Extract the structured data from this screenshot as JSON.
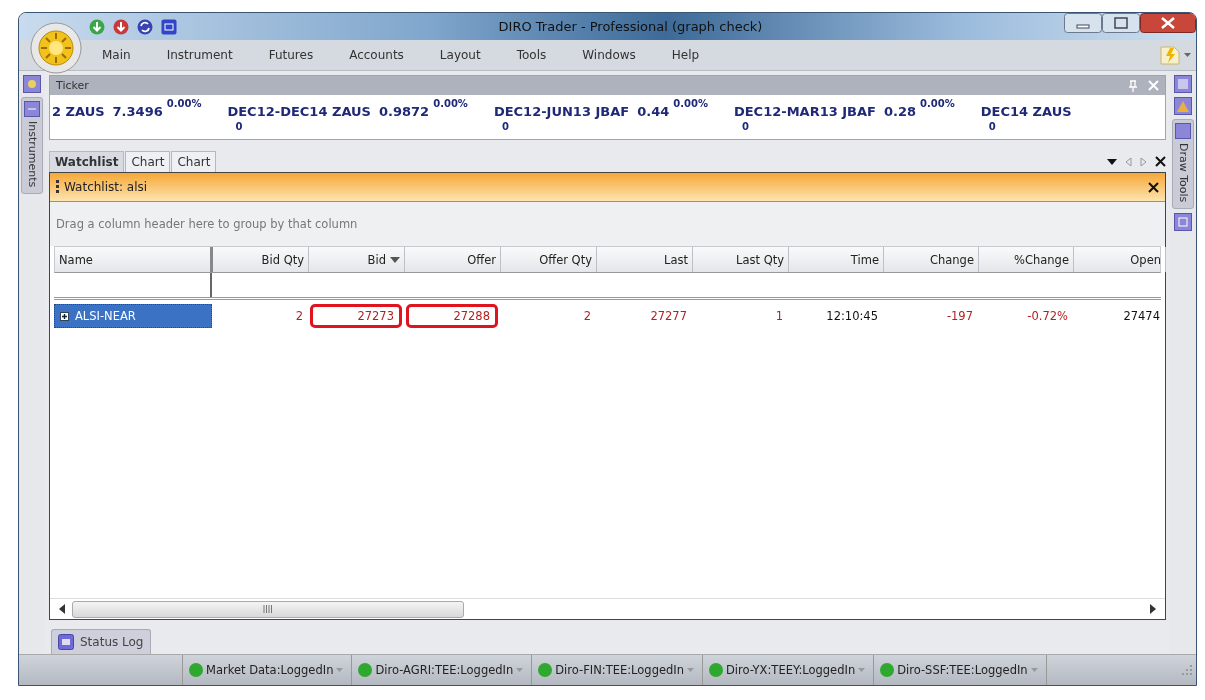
{
  "window": {
    "title": "DIRO Trader - Professional (graph check)"
  },
  "menu": [
    {
      "label": "Main"
    },
    {
      "label": "Instrument"
    },
    {
      "label": "Futures"
    },
    {
      "label": "Accounts"
    },
    {
      "label": "Layout"
    },
    {
      "label": "Tools"
    },
    {
      "label": "Windows"
    },
    {
      "label": "Help"
    }
  ],
  "left_dock": {
    "tabs": [
      {
        "label": "Instruments"
      }
    ]
  },
  "right_dock": {
    "tabs": [
      {
        "label": "Draw Tools"
      }
    ]
  },
  "ticker": {
    "title": "Ticker",
    "items": [
      {
        "symbol": "2 ZAUS",
        "price": "7.3496",
        "change": "0.00%"
      },
      {
        "symbol": "DEC12-DEC14 ZAUS",
        "price": "0.9872",
        "change": "0.00%",
        "volume": "0"
      },
      {
        "symbol": "DEC12-JUN13 JBAF",
        "price": "0.44",
        "change": "0.00%",
        "volume": "0"
      },
      {
        "symbol": "DEC12-MAR13 JBAF",
        "price": "0.28",
        "change": "0.00%",
        "volume": "0"
      },
      {
        "symbol": "DEC14 ZAUS",
        "volume": "0"
      }
    ]
  },
  "tabs": [
    {
      "label": "Watchlist",
      "selected": true
    },
    {
      "label": "Chart",
      "selected": false
    },
    {
      "label": "Chart",
      "selected": false
    }
  ],
  "watchlist": {
    "title": "Watchlist: alsi",
    "group_hint": "Drag a column header here to group by that column",
    "columns": [
      {
        "label": "Name"
      },
      {
        "label": "Bid Qty"
      },
      {
        "label": "Bid",
        "sorted": true
      },
      {
        "label": "Offer"
      },
      {
        "label": "Offer Qty"
      },
      {
        "label": "Last"
      },
      {
        "label": "Last Qty"
      },
      {
        "label": "Time"
      },
      {
        "label": "Change"
      },
      {
        "label": "%Change"
      },
      {
        "label": "Open"
      }
    ],
    "rows": [
      {
        "selected": true,
        "cells": [
          {
            "text": "ALSI-NEAR"
          },
          {
            "text": "2",
            "color": "#b22222"
          },
          {
            "text": "27273",
            "color": "#b22222",
            "highlighted": true
          },
          {
            "text": "27288",
            "color": "#b22222",
            "highlighted": true
          },
          {
            "text": "2",
            "color": "#b22222"
          },
          {
            "text": "27277",
            "color": "#b22222"
          },
          {
            "text": "1",
            "color": "#b22222"
          },
          {
            "text": "12:10:45",
            "color": "#111111"
          },
          {
            "text": "-197",
            "color": "#b22222"
          },
          {
            "text": "-0.72%",
            "color": "#b22222"
          },
          {
            "text": "27474",
            "color": "#111111"
          }
        ]
      }
    ]
  },
  "bottom_tabs": [
    {
      "label": "Status Log"
    }
  ],
  "status_bar": [
    {
      "label": "Market Data:LoggedIn",
      "color": "#2ea82e"
    },
    {
      "label": "Diro-AGRI:TEE:LoggedIn",
      "color": "#2ea82e"
    },
    {
      "label": "Diro-FIN:TEE:LoggedIn",
      "color": "#2ea82e"
    },
    {
      "label": "Diro-YX:TEEY:LoggedIn",
      "color": "#2ea82e"
    },
    {
      "label": "Diro-SSF:TEE:LoggedIn",
      "color": "#2ea82e"
    }
  ]
}
